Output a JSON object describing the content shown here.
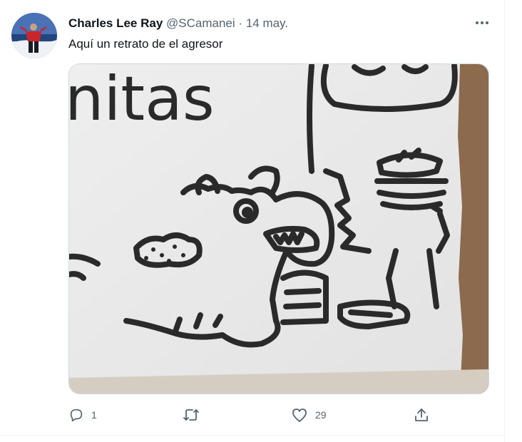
{
  "tweet": {
    "author_name": "Charles Lee Ray",
    "author_handle": "@SCamanei",
    "separator": "·",
    "date": "14 may.",
    "text": "Aquí un retrato de el agresor",
    "image_text": "nitas"
  },
  "actions": {
    "reply_count": "1",
    "retweet_count": "",
    "like_count": "29"
  },
  "icons": {
    "more": "more-horizontal-icon",
    "reply": "reply-icon",
    "retweet": "retweet-icon",
    "like": "heart-icon",
    "share": "share-icon"
  },
  "colors": {
    "text": "#0f1419",
    "secondary": "#536471",
    "border": "#eff3f4"
  }
}
